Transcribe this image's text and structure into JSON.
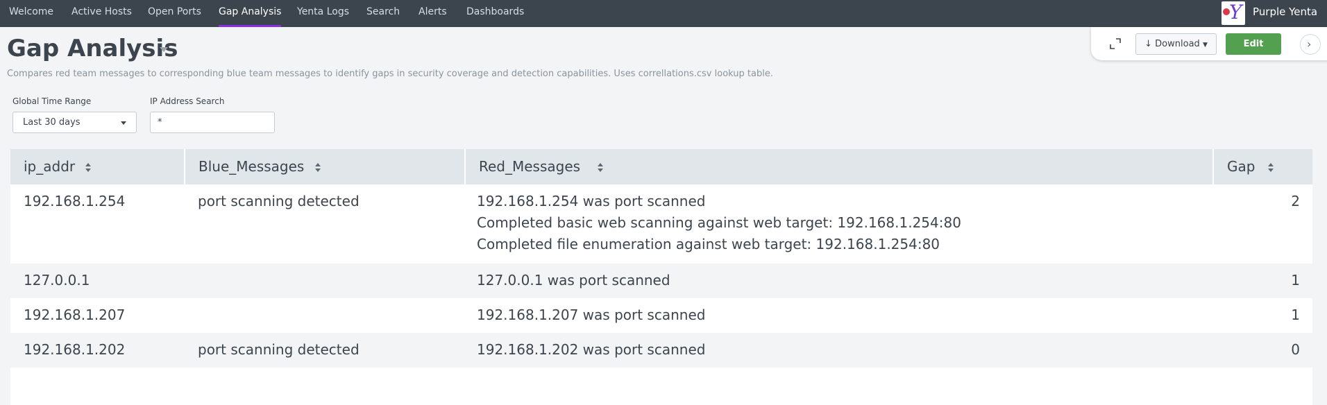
{
  "nav": {
    "items": [
      {
        "label": "Welcome"
      },
      {
        "label": "Active Hosts"
      },
      {
        "label": "Open Ports"
      },
      {
        "label": "Gap Analysis",
        "active": true
      },
      {
        "label": "Yenta Logs"
      },
      {
        "label": "Search"
      },
      {
        "label": "Alerts"
      },
      {
        "label": "Dashboards"
      }
    ],
    "app_logo_letter": "Y",
    "app_name": "Purple Yenta"
  },
  "header": {
    "title": "Gap Analysis",
    "description": "Compares red team messages to corresponding blue team messages to identify gaps in security coverage and detection capabilities. Uses correllations.csv lookup table.",
    "download_label": "Download",
    "edit_label": "Edit"
  },
  "inputs": {
    "time_range": {
      "label": "Global Time Range",
      "value": "Last 30 days"
    },
    "ip_search": {
      "label": "IP Address Search",
      "value": "*"
    }
  },
  "table": {
    "columns": [
      "ip_addr",
      "Blue_Messages",
      "Red_Messages",
      "Gap"
    ],
    "rows": [
      {
        "ip_addr": "192.168.1.254",
        "blue": [
          "port scanning detected"
        ],
        "red": [
          "192.168.1.254 was port scanned",
          "Completed basic web scanning against web target: 192.168.1.254:80",
          "Completed file enumeration against web target: 192.168.1.254:80"
        ],
        "gap": "2"
      },
      {
        "ip_addr": "127.0.0.1",
        "blue": [],
        "red": [
          "127.0.0.1 was port scanned"
        ],
        "gap": "1"
      },
      {
        "ip_addr": "192.168.1.207",
        "blue": [],
        "red": [
          "192.168.1.207 was port scanned"
        ],
        "gap": "1"
      },
      {
        "ip_addr": "192.168.1.202",
        "blue": [
          "port scanning detected"
        ],
        "red": [
          "192.168.1.202 was port scanned"
        ],
        "gap": "0"
      }
    ]
  },
  "colors": {
    "nav_bg": "#3c444d",
    "nav_active_underline": "#8c2ee6",
    "edit_button": "#53a051",
    "header_row": "#e1e6eb"
  }
}
